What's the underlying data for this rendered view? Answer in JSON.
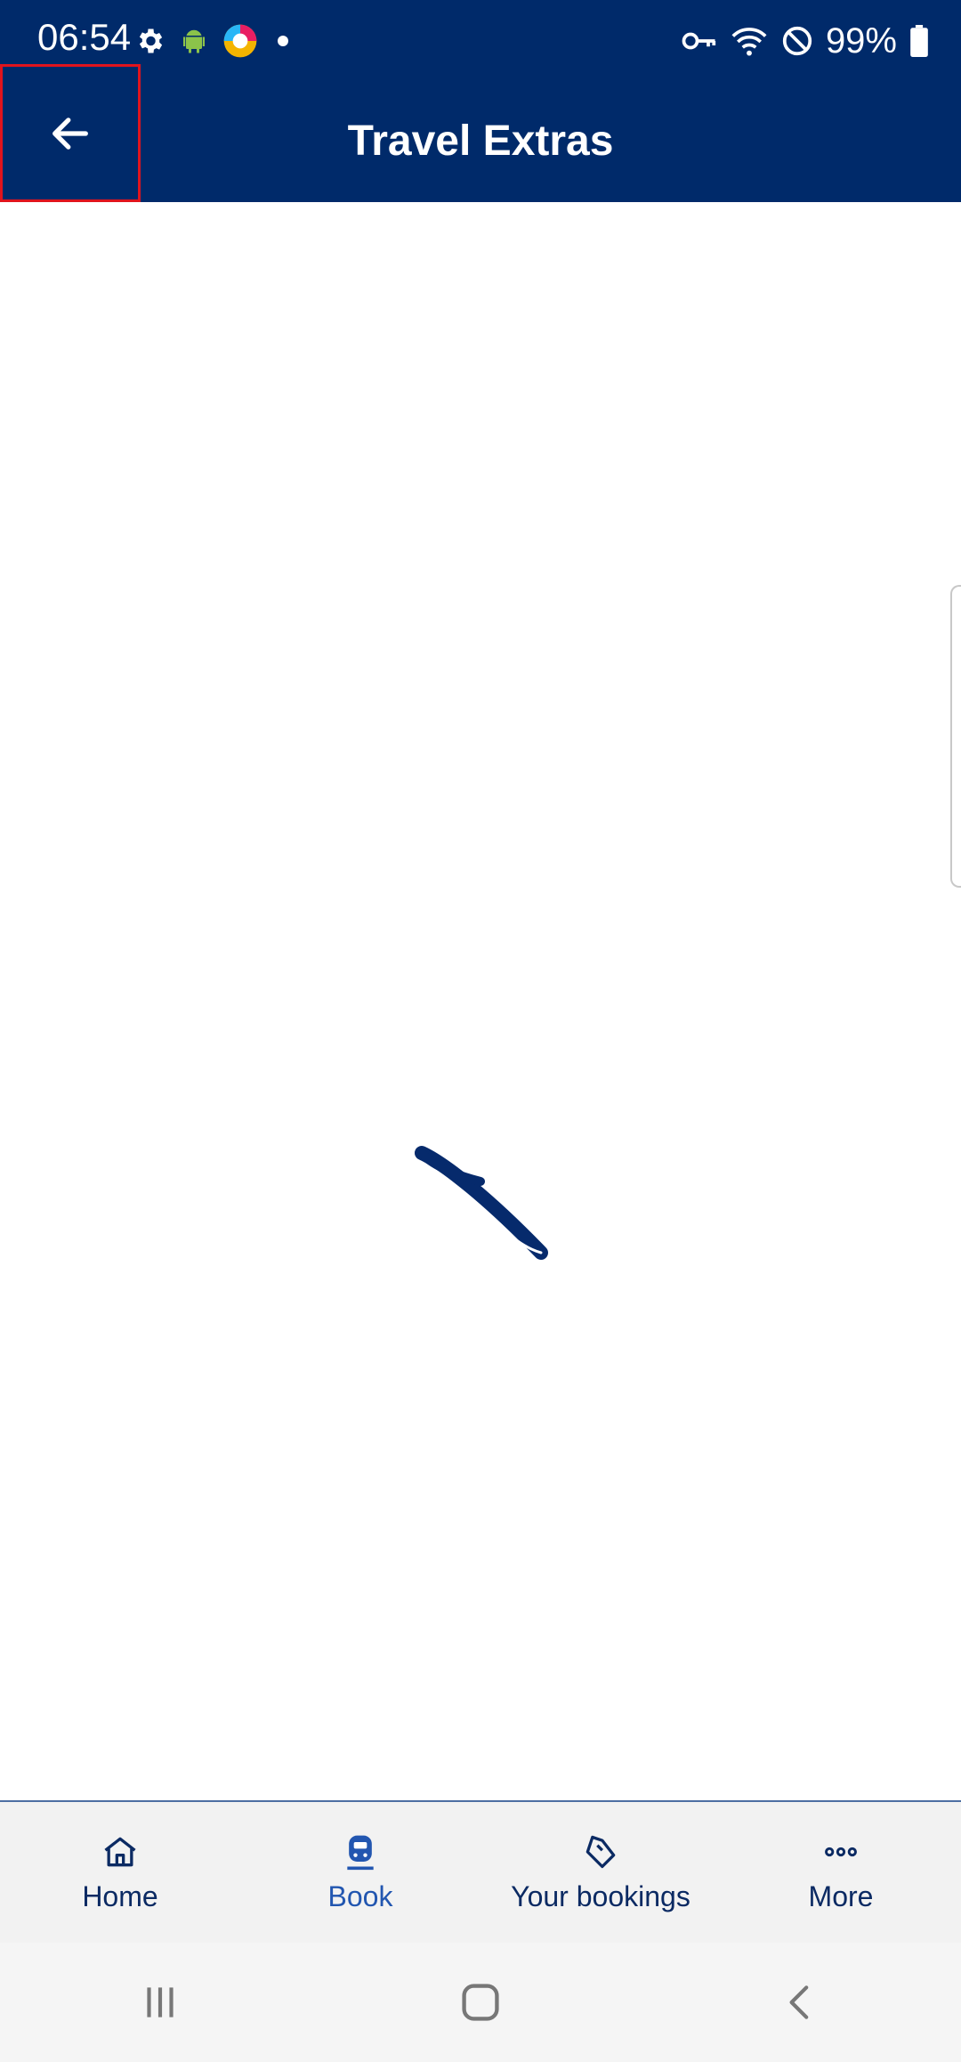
{
  "status_bar": {
    "time": "06:54",
    "battery": "99%"
  },
  "app_bar": {
    "title": "Travel Extras"
  },
  "bottom_nav": {
    "items": [
      {
        "label": "Home",
        "icon": "home-icon"
      },
      {
        "label": "Book",
        "icon": "train-icon",
        "active": true
      },
      {
        "label": "Your bookings",
        "icon": "ticket-icon"
      },
      {
        "label": "More",
        "icon": "more-dots-icon"
      }
    ]
  },
  "colors": {
    "brand_navy": "#002a6a",
    "active_blue": "#2256b0",
    "highlight_red": "#e0141d"
  }
}
